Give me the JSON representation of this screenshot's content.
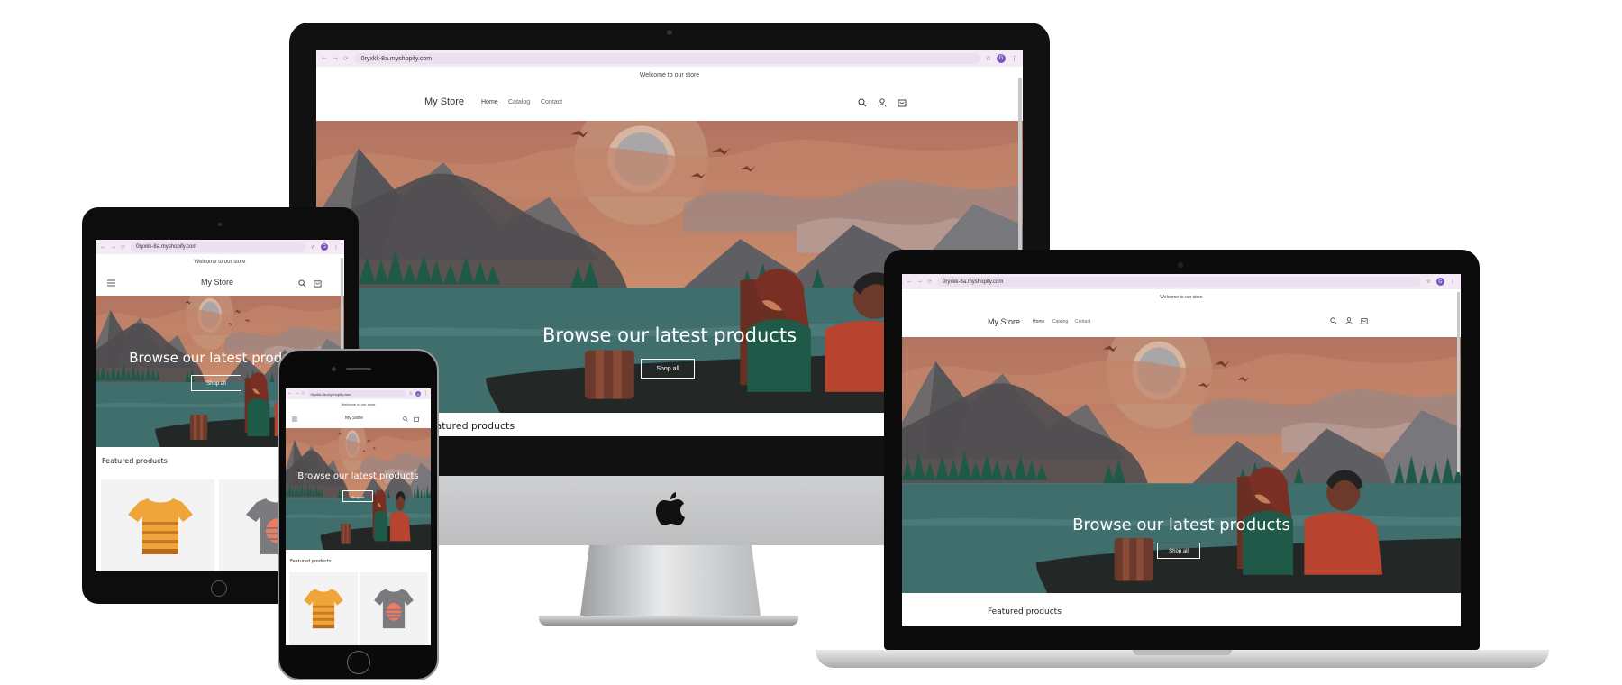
{
  "browser": {
    "url": "0ryxkk-8a.myshopify.com",
    "avatar_letter": "G",
    "back": "←",
    "forward": "→",
    "reload": "⟳",
    "star": "☆",
    "menu": "⋮"
  },
  "store": {
    "announcement": "Welcome to our store",
    "name": "My Store",
    "nav": [
      "Home",
      "Catalog",
      "Contact"
    ],
    "hero_heading": "Browse our latest products",
    "hero_button": "Shop all",
    "featured_heading": "Featured products"
  },
  "icons": {
    "search": "search-icon",
    "account": "account-icon",
    "cart": "cart-icon",
    "menu": "hamburger-icon",
    "brand": "apple-logo-icon"
  },
  "colors": {
    "sky": "#c2876a",
    "water": "#3f6e6d",
    "boat": "#232826",
    "brand_purple": "#7a56c5",
    "chrome": "#f3eaf6",
    "tshirt_orange": "#f0a53a",
    "tshirt_gray": "#7b7b7f",
    "tshirt_coral": "#ef7a63"
  }
}
